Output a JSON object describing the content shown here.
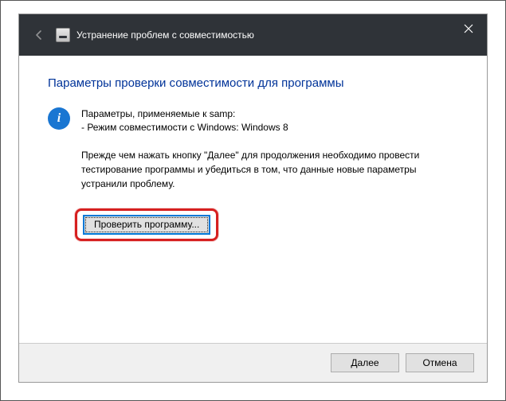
{
  "titlebar": {
    "title": "Устранение проблем с совместимостью"
  },
  "content": {
    "heading": "Параметры проверки совместимости для программы",
    "info_line1": "Параметры, применяемые к samp:",
    "info_line2": "- Режим совместимости с Windows: Windows 8",
    "instruction": "Прежде чем нажать кнопку \"Далее\" для продолжения необходимо провести тестирование программы и убедиться в том, что данные новые параметры устранили проблему.",
    "test_button": "Проверить программу..."
  },
  "footer": {
    "next": "Далее",
    "cancel": "Отмена"
  }
}
